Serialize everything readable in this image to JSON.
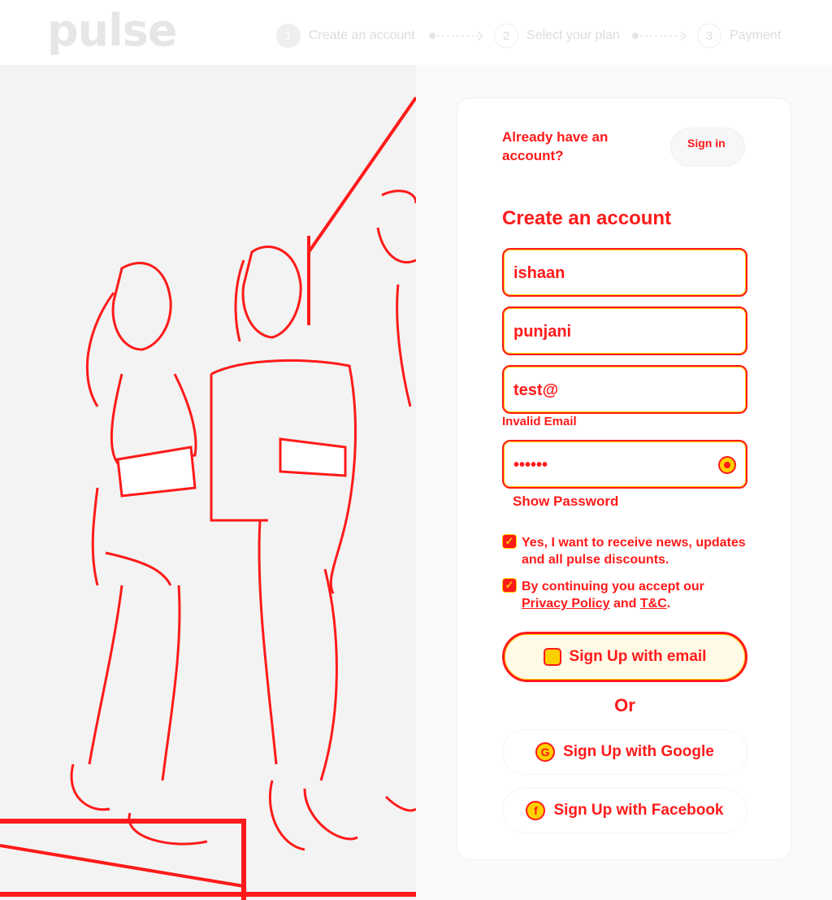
{
  "header": {
    "logo": "pulse",
    "steps": [
      {
        "number": "1",
        "label": "Create an account"
      },
      {
        "number": "2",
        "label": "Select your plan"
      },
      {
        "number": "3",
        "label": "Payment"
      }
    ]
  },
  "auth": {
    "already_text": "Already have an account?",
    "signin_label": "Sign in"
  },
  "form": {
    "title": "Create an account",
    "first_name": "ishaan",
    "last_name": "punjani",
    "email": "test@",
    "email_error": "Invalid Email",
    "password_mask": "••••••",
    "show_password": "Show Password",
    "consent_news": "Yes, I want to receive news, updates and all pulse discounts.",
    "consent_terms_prefix": "By continuing you accept our ",
    "privacy_link": "Privacy Policy",
    "terms_and": " and ",
    "tc_link": "T&C",
    "terms_suffix": ".",
    "email_button": "Sign Up with email",
    "or": "Or",
    "google_button": "Sign Up with Google",
    "facebook_button": "Sign Up with Facebook"
  },
  "icons": {
    "email": "email-icon",
    "google": "google-icon",
    "facebook": "facebook-icon",
    "eye": "eye-icon",
    "check": "check-icon"
  },
  "colors": {
    "accent": "#ff1a1a",
    "highlight": "#ffd000"
  }
}
